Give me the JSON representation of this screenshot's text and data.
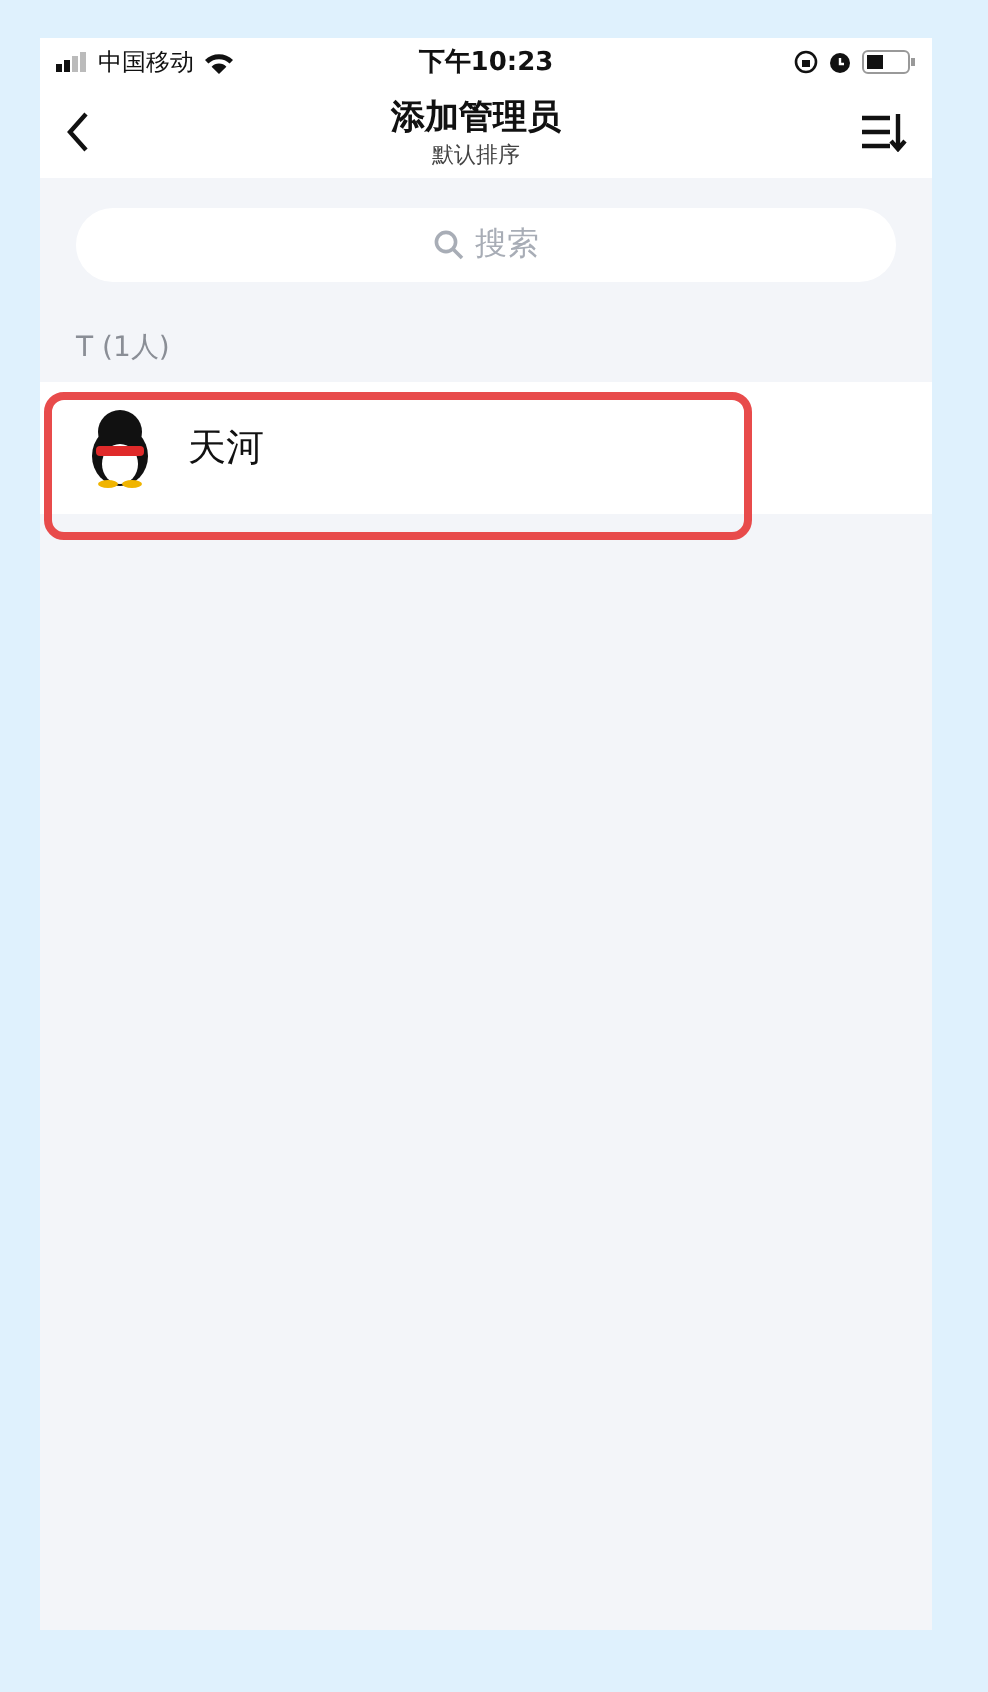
{
  "status_bar": {
    "carrier": "中国移动",
    "time": "下午10:23"
  },
  "nav_bar": {
    "title": "添加管理员",
    "subtitle": "默认排序"
  },
  "search": {
    "placeholder": "搜索"
  },
  "sections": [
    {
      "header": "T (1人)",
      "members": [
        {
          "name": "天河",
          "highlighted": true
        }
      ]
    }
  ]
}
